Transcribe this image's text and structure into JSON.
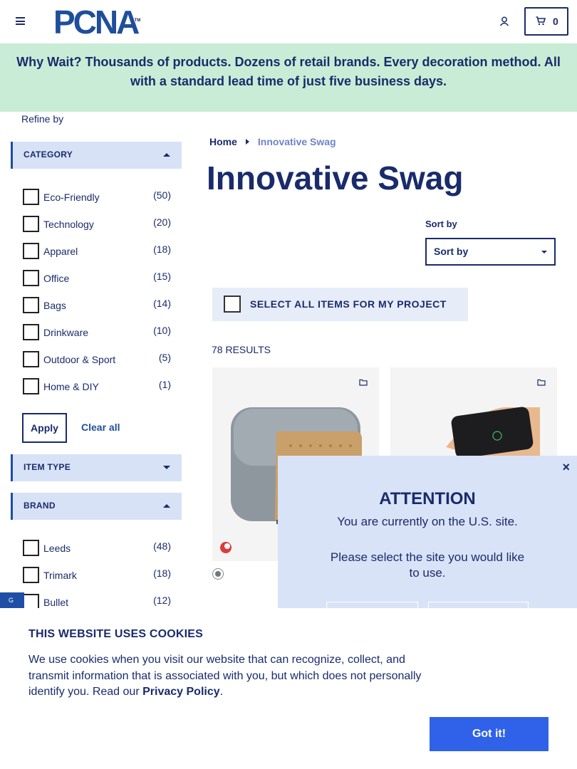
{
  "header": {
    "logo_text": "PCNA",
    "logo_tm": "TM",
    "cart_count": "0"
  },
  "banner": {
    "text": "Why Wait? Thousands of products. Dozens of retail brands. Every decoration method. All with a standard lead time of just five business days."
  },
  "sidebar": {
    "refine_label": "Refine by",
    "category": {
      "heading": "CATEGORY",
      "items": [
        {
          "label": "Eco-Friendly",
          "count": "(50)"
        },
        {
          "label": "Technology",
          "count": "(20)"
        },
        {
          "label": "Apparel",
          "count": "(18)"
        },
        {
          "label": "Office",
          "count": "(15)"
        },
        {
          "label": "Bags",
          "count": "(14)"
        },
        {
          "label": "Drinkware",
          "count": "(10)"
        },
        {
          "label": "Outdoor & Sport",
          "count": "(5)"
        },
        {
          "label": "Home & DIY",
          "count": "(1)"
        }
      ]
    },
    "apply_label": "Apply",
    "clear_label": "Clear all",
    "item_type": {
      "heading": "ITEM TYPE"
    },
    "brand": {
      "heading": "BRAND",
      "items": [
        {
          "label": "Leeds",
          "count": "(48)"
        },
        {
          "label": "Trimark",
          "count": "(18)"
        },
        {
          "label": "Bullet",
          "count": "(12)"
        }
      ]
    }
  },
  "main": {
    "breadcrumb": {
      "home": "Home",
      "current": "Innovative Swag"
    },
    "title": "Innovative Swag",
    "sort": {
      "label": "Sort by",
      "value": "Sort by"
    },
    "select_all_label": "SELECT ALL ITEMS FOR MY PROJECT",
    "results": "78 RESULTS"
  },
  "attention": {
    "close": "×",
    "title": "ATTENTION",
    "line1": "You are currently on the U.S. site.",
    "line2": "Please select the site you would like to use."
  },
  "side_tab": {
    "label": "G"
  },
  "cookie": {
    "title": "THIS WEBSITE USES COOKIES",
    "text": "We use cookies when you visit our website that can recognize, collect, and transmit information that is associated with you, but which does not personally identify you. Read our",
    "link": "Privacy Policy",
    "period": ".",
    "button": "Got it!"
  },
  "colors": {
    "navy": "#1a2b6b",
    "brand_blue": "#1f4e9c",
    "banner_green": "#c9ecd6",
    "button_blue": "#2f62e8"
  }
}
